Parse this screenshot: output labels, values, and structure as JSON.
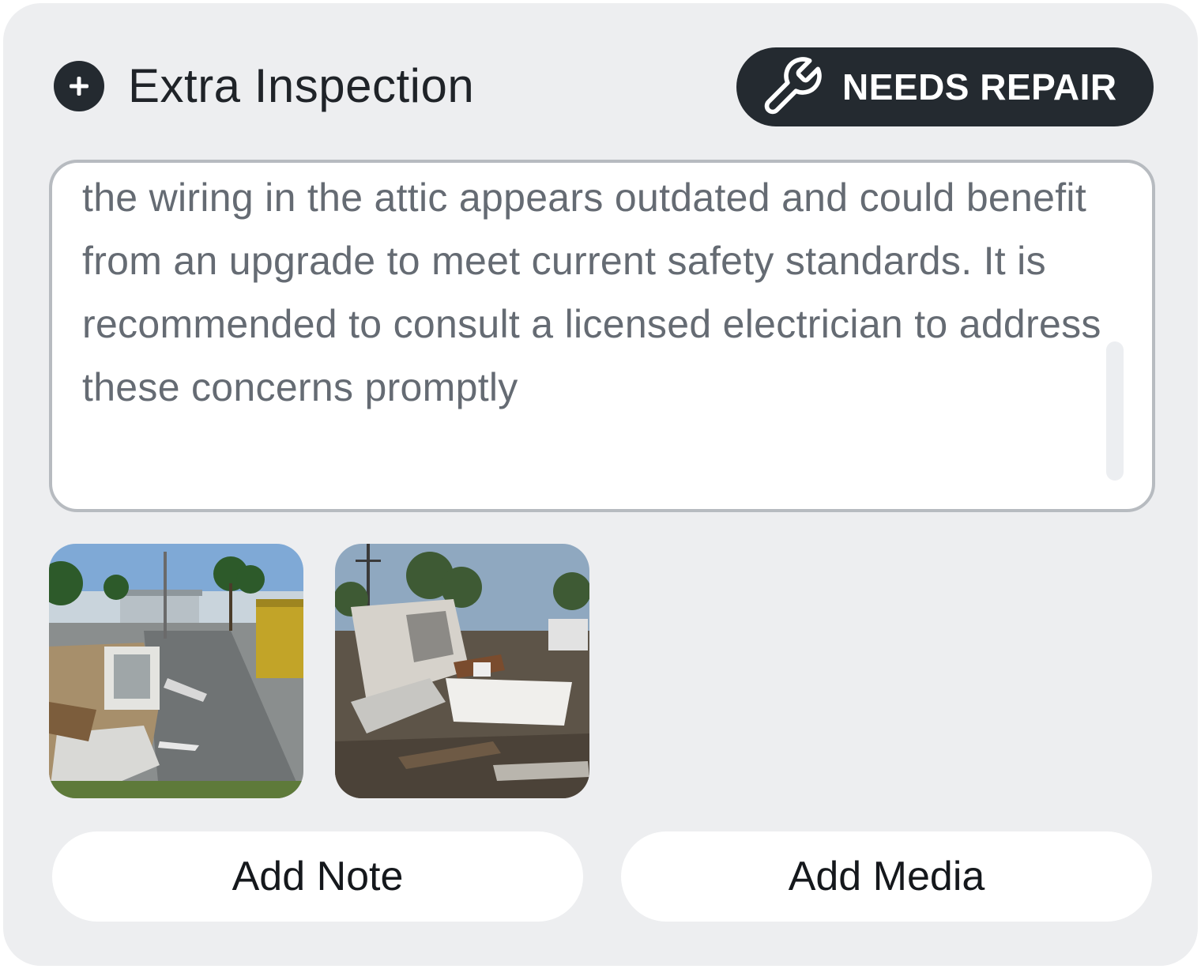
{
  "header": {
    "title": "Extra Inspection",
    "icon": "plus-circle-icon"
  },
  "status": {
    "label": "NEEDS REPAIR",
    "icon": "wrench-icon",
    "color": "#242a30"
  },
  "notes": {
    "text": "the wiring in the attic appears outdated and could benefit from an upgrade to meet current safety standards. It is recommended to consult a licensed electrician to address these concerns promptly"
  },
  "media": [
    {
      "name": "damage-photo-street"
    },
    {
      "name": "damage-photo-collapsed-house"
    }
  ],
  "actions": {
    "add_note": "Add Note",
    "add_media": "Add Media"
  },
  "colors": {
    "card_background": "#edeef0",
    "dark": "#242a30",
    "notes_text": "#656b73"
  }
}
